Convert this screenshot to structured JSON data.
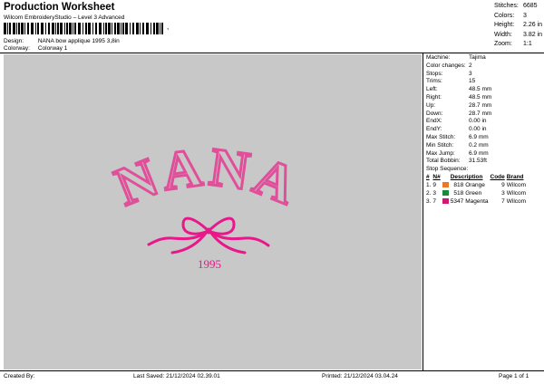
{
  "header": {
    "title": "Production Worksheet",
    "subtitle": "Wilcom EmbroideryStudio – Level 3 Advanced",
    "barcode_char": ",",
    "design_label": "Design:",
    "design_value": "NANA bow applique 1995 3,8in",
    "colorway_label": "Colorway:",
    "colorway_value": "Colorway 1"
  },
  "stats": [
    {
      "k": "Stitches:",
      "v": "6685"
    },
    {
      "k": "Colors:",
      "v": "3"
    },
    {
      "k": "Height:",
      "v": "2.26 in"
    },
    {
      "k": "Width:",
      "v": "3.82 in"
    },
    {
      "k": "Zoom:",
      "v": "1:1"
    }
  ],
  "design": {
    "word": "NANA",
    "year": "1995",
    "colors": {
      "outline": "#e0509a",
      "fill": "#c8c8c8",
      "bow": "#e8178a"
    }
  },
  "machine_info": [
    {
      "k": "Machine:",
      "v": "Tajima"
    },
    {
      "k": "Color changes:",
      "v": "2"
    },
    {
      "k": "Stops:",
      "v": "3"
    },
    {
      "k": "Trims:",
      "v": "15"
    },
    {
      "k": "Left:",
      "v": "48.5 mm"
    },
    {
      "k": "Right:",
      "v": "48.5 mm"
    },
    {
      "k": "Up:",
      "v": "28.7 mm"
    },
    {
      "k": "Down:",
      "v": "28.7 mm"
    },
    {
      "k": "EndX:",
      "v": "0.00 in"
    },
    {
      "k": "EndY:",
      "v": "0.00 in"
    },
    {
      "k": "Max Stitch:",
      "v": "6.9 mm"
    },
    {
      "k": "Min Stitch:",
      "v": "0.2 mm"
    },
    {
      "k": "Max Jump:",
      "v": "6.9 mm"
    },
    {
      "k": "Total Bobbin:",
      "v": "31.53ft"
    }
  ],
  "stop_sequence": {
    "title": "Stop Sequence:",
    "headers": [
      "#",
      "N#",
      "",
      "Description",
      "Code",
      "Brand"
    ],
    "rows": [
      {
        "idx": "1.",
        "n": "9",
        "color": "#e8792a",
        "code_left": "818",
        "desc": "Orange",
        "code": "9",
        "brand": "Wilcom"
      },
      {
        "idx": "2.",
        "n": "3",
        "color": "#1a8a3a",
        "code_left": "518",
        "desc": "Green",
        "code": "3",
        "brand": "Wilcom"
      },
      {
        "idx": "3.",
        "n": "7",
        "color": "#d01870",
        "code_left": "5347",
        "desc": "Magenta",
        "code": "7",
        "brand": "Wilcom"
      }
    ]
  },
  "footer": {
    "created_by": "Created By:",
    "last_saved": "Last Saved: 21/12/2024 02.39.01",
    "printed": "Printed: 21/12/2024 03.04.24",
    "page": "Page 1 of 1"
  }
}
